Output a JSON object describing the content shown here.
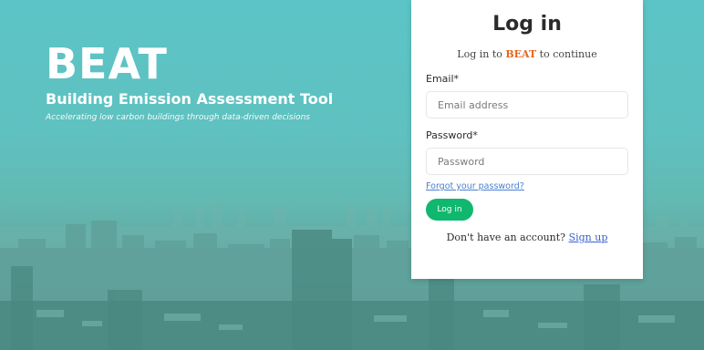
{
  "hero": {
    "title": "BEAT",
    "subtitle": "Building Emission Assessment Tool",
    "tagline": "Accelerating low carbon buildings through data-driven decisions"
  },
  "login": {
    "title": "Log in",
    "subtitle_prefix": "Log in to ",
    "subtitle_brand": "BEAT",
    "subtitle_suffix": " to continue",
    "email_label": "Email*",
    "email_placeholder": "Email address",
    "email_value": "",
    "password_label": "Password*",
    "password_placeholder": "Password",
    "password_value": "",
    "forgot_link": "Forgot your password?",
    "submit_label": "Log in",
    "signup_prompt": "Don't have an account? ",
    "signup_link": "Sign up"
  },
  "colors": {
    "brand_orange": "#e8641e",
    "button_green": "#10b86f",
    "link_blue": "#4a7fd1",
    "background_teal": "#5cc4c6"
  },
  "icons": {
    "background": "city-skyline-image"
  }
}
